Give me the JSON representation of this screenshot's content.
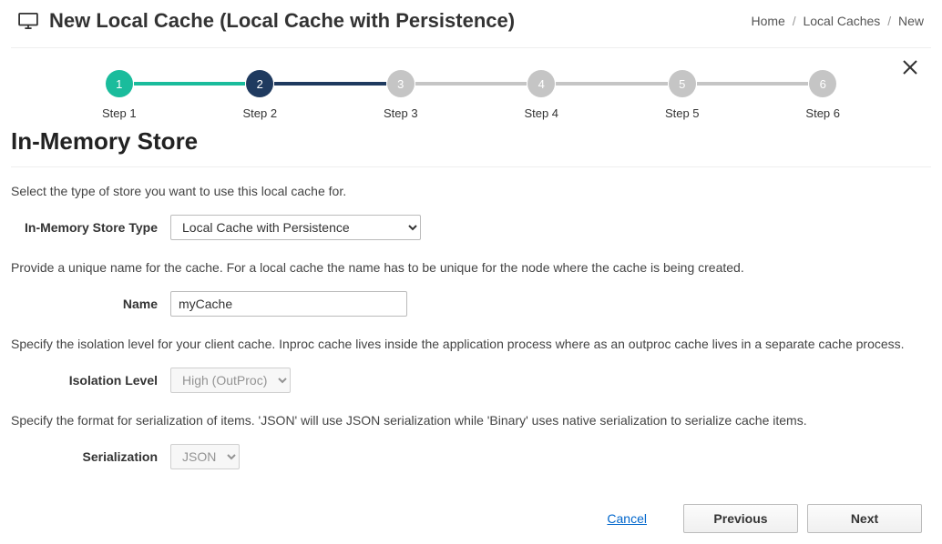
{
  "header": {
    "title": "New Local Cache (Local Cache with Persistence)"
  },
  "breadcrumb": {
    "items": [
      "Home",
      "Local Caches",
      "New"
    ],
    "separator": "/"
  },
  "stepper": {
    "steps": [
      {
        "num": "1",
        "label": "Step 1",
        "state": "done"
      },
      {
        "num": "2",
        "label": "Step 2",
        "state": "active"
      },
      {
        "num": "3",
        "label": "Step 3",
        "state": "pending"
      },
      {
        "num": "4",
        "label": "Step 4",
        "state": "pending"
      },
      {
        "num": "5",
        "label": "Step 5",
        "state": "pending"
      },
      {
        "num": "6",
        "label": "Step 6",
        "state": "pending"
      }
    ]
  },
  "section": {
    "heading": "In-Memory Store",
    "store_type_help": "Select the type of store you want to use this local cache for.",
    "name_help": "Provide a unique name for the cache. For a local cache the name has to be unique for the node where the cache is being created.",
    "isolation_help": "Specify the isolation level for your client cache. Inproc cache lives inside the application process where as an outproc cache lives in a separate cache process.",
    "serialization_help": "Specify the format for serialization of items. 'JSON' will use JSON serialization while 'Binary' uses native serialization to serialize cache items."
  },
  "form": {
    "store_type_label": "In-Memory Store Type",
    "store_type_value": "Local Cache with Persistence",
    "name_label": "Name",
    "name_value": "myCache",
    "isolation_label": "Isolation Level",
    "isolation_value": "High (OutProc)",
    "serialization_label": "Serialization",
    "serialization_value": "JSON"
  },
  "footer": {
    "cancel": "Cancel",
    "previous": "Previous",
    "next": "Next"
  }
}
